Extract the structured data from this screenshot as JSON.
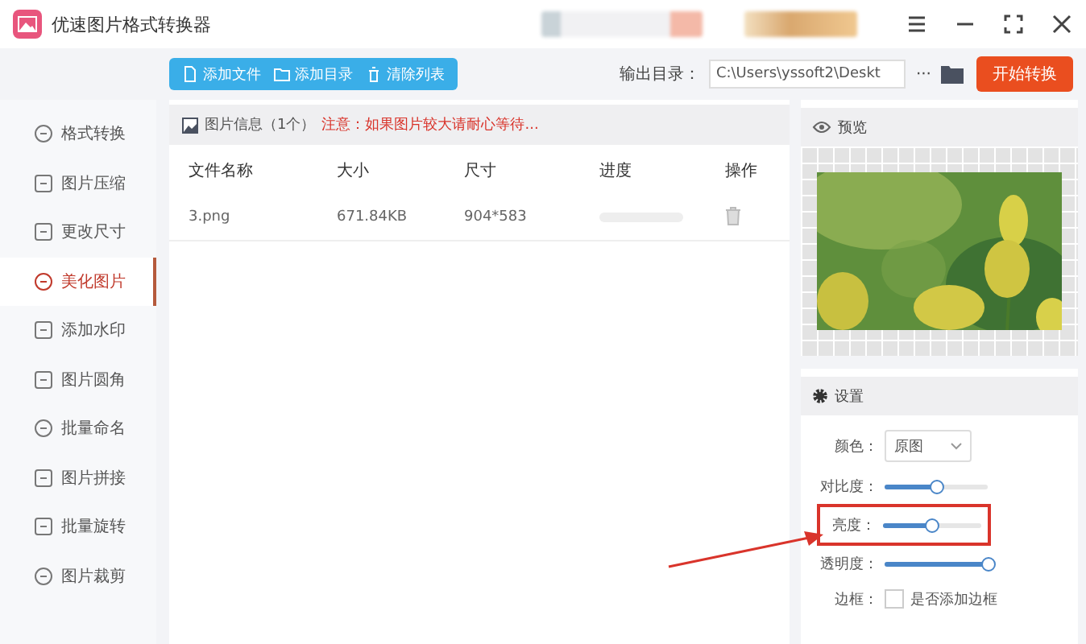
{
  "window": {
    "title": "优速图片格式转换器"
  },
  "toolbar": {
    "buttons": [
      "添加文件",
      "添加目录",
      "清除列表"
    ],
    "output_label": "输出目录：",
    "output_path": "C:\\Users\\yssoft2\\Deskt",
    "more": "···",
    "start_button": "开始转换"
  },
  "sidebar": {
    "items": [
      {
        "label": "格式转换",
        "selected": false
      },
      {
        "label": "图片压缩",
        "selected": false
      },
      {
        "label": "更改尺寸",
        "selected": false
      },
      {
        "label": "美化图片",
        "selected": true
      },
      {
        "label": "添加水印",
        "selected": false
      },
      {
        "label": "图片圆角",
        "selected": false
      },
      {
        "label": "批量命名",
        "selected": false
      },
      {
        "label": "图片拼接",
        "selected": false
      },
      {
        "label": "批量旋转",
        "selected": false
      },
      {
        "label": "图片裁剪",
        "selected": false
      }
    ]
  },
  "file_panel": {
    "title": "图片信息（1个）",
    "notice": "注意：如果图片较大请耐心等待...",
    "columns": [
      "文件名称",
      "大小",
      "尺寸",
      "进度",
      "操作"
    ],
    "rows": [
      {
        "name": "3.png",
        "size": "671.84KB",
        "dimensions": "904*583",
        "level": 0
      }
    ]
  },
  "preview": {
    "title": "预览"
  },
  "settings": {
    "title": "设置",
    "color_label": "颜色：",
    "color_value": "原图",
    "sliders": [
      {
        "label": "对比度：",
        "level": 0.5,
        "highlighted": false
      },
      {
        "label": "亮度：",
        "level": 0.5,
        "highlighted": true
      },
      {
        "label": "透明度：",
        "level": 1,
        "highlighted": false
      }
    ],
    "border": {
      "label": "边框：",
      "option": "是否添加边框",
      "checked": false
    }
  }
}
